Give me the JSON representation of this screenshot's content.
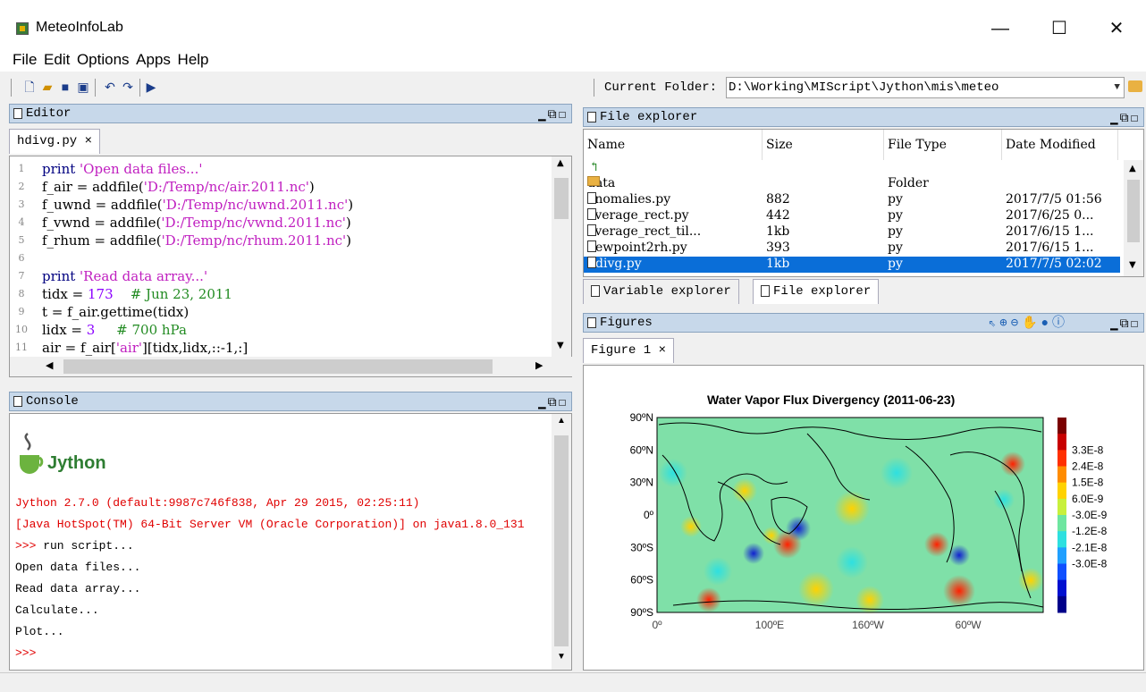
{
  "window": {
    "title": "MeteoInfoLab",
    "minimize": "—",
    "maximize": "☐",
    "close": "✕"
  },
  "menu": [
    "File",
    "Edit",
    "Options",
    "Apps",
    "Help"
  ],
  "folder": {
    "label": "Current Folder:",
    "path": "D:\\Working\\MIScript\\Jython\\mis\\meteo"
  },
  "editor": {
    "title": "Editor",
    "tab": "hdivg.py ×",
    "lines": [
      {
        "n": "1",
        "html": "<span class='k'>print</span> <span class='s'>'Open data files...'</span>"
      },
      {
        "n": "2",
        "html": "f_air = addfile(<span class='s'>'D:/Temp/nc/air.2011.nc'</span>)"
      },
      {
        "n": "3",
        "html": "f_uwnd = addfile(<span class='s'>'D:/Temp/nc/uwnd.2011.nc'</span>)"
      },
      {
        "n": "4",
        "html": "f_vwnd = addfile(<span class='s'>'D:/Temp/nc/vwnd.2011.nc'</span>)"
      },
      {
        "n": "5",
        "html": "f_rhum = addfile(<span class='s'>'D:/Temp/nc/rhum.2011.nc'</span>)"
      },
      {
        "n": "6",
        "html": ""
      },
      {
        "n": "7",
        "html": "<span class='k'>print</span> <span class='s'>'Read data array...'</span>"
      },
      {
        "n": "8",
        "html": "tidx = <span class='n'>173</span>    <span class='c'># Jun 23, 2011</span>"
      },
      {
        "n": "9",
        "html": "t = f_air.gettime(tidx)"
      },
      {
        "n": "10",
        "html": "lidx = <span class='n'>3</span>     <span class='c'># 700 hPa</span>"
      },
      {
        "n": "11",
        "html": "air = f_air[<span class='s'>'air'</span>][tidx,lidx,::-1,:]"
      }
    ]
  },
  "console": {
    "title": "Console",
    "logo": "Jython",
    "lines": [
      {
        "text": "Jython 2.7.0 (default:9987c746f838, Apr 29 2015, 02:25:11)",
        "red": true
      },
      {
        "text": "[Java HotSpot(TM) 64-Bit Server VM (Oracle Corporation)] on java1.8.0_131",
        "red": true
      },
      {
        "text": ">>> run script...",
        "red": false,
        "prompt": ">>>"
      },
      {
        "text": "Open data files...",
        "red": false
      },
      {
        "text": "Read data array...",
        "red": false
      },
      {
        "text": "Calculate...",
        "red": false
      },
      {
        "text": "Plot...",
        "red": false
      },
      {
        "text": ">>>",
        "red": true
      }
    ]
  },
  "file_explorer": {
    "title": "File explorer",
    "columns": [
      "Name",
      "Size",
      "File Type",
      "Date Modified"
    ],
    "rows": [
      {
        "name": "data",
        "size": "",
        "type": "Folder",
        "date": "",
        "folder": true
      },
      {
        "name": "anomalies.py",
        "size": "882",
        "type": "py",
        "date": "2017/7/5 01:56"
      },
      {
        "name": "average_rect.py",
        "size": "442",
        "type": "py",
        "date": "2017/6/25 0..."
      },
      {
        "name": "average_rect_til...",
        "size": "1kb",
        "type": "py",
        "date": "2017/6/15 1..."
      },
      {
        "name": "dewpoint2rh.py",
        "size": "393",
        "type": "py",
        "date": "2017/6/15 1..."
      },
      {
        "name": "hdivg.py",
        "size": "1kb",
        "type": "py",
        "date": "2017/7/5 02:02",
        "selected": true
      }
    ],
    "tabs": [
      "Variable explorer",
      "File explorer"
    ]
  },
  "figures": {
    "title": "Figures",
    "tab": "Figure 1 ×",
    "plot_title": "Water Vapor Flux Divergency (2011-06-23)",
    "y_ticks": [
      "90ºN",
      "60ºN",
      "30ºN",
      "0º",
      "30ºS",
      "60ºS",
      "90ºS"
    ],
    "x_ticks": [
      "0º",
      "100ºE",
      "160ºW",
      "60ºW"
    ],
    "legend": [
      "3.3E-8",
      "2.4E-8",
      "1.5E-8",
      "6.0E-9",
      "-3.0E-9",
      "-1.2E-8",
      "-2.1E-8",
      "-3.0E-8"
    ],
    "legend_colors": [
      "#7a0000",
      "#c80000",
      "#ff3000",
      "#ff8c00",
      "#ffd200",
      "#c8f03c",
      "#6ee6a0",
      "#2ee0e0",
      "#20a0ff",
      "#1050ff",
      "#0010d0",
      "#00008a"
    ]
  }
}
